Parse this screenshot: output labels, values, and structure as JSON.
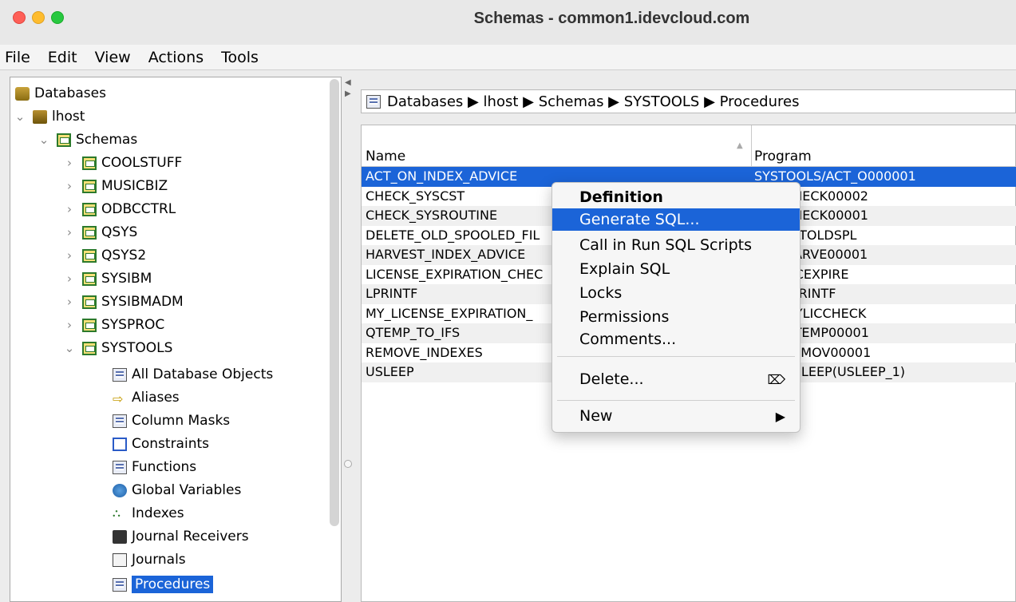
{
  "window": {
    "title": "Schemas - common1.idevcloud.com"
  },
  "menubar": [
    "File",
    "Edit",
    "View",
    "Actions",
    "Tools"
  ],
  "tree": {
    "root": "Databases",
    "host": "lhost",
    "schemas_label": "Schemas",
    "schemas": [
      "COOLSTUFF",
      "MUSICBIZ",
      "ODBCCTRL",
      "QSYS",
      "QSYS2",
      "SYSIBM",
      "SYSIBMADM",
      "SYSPROC",
      "SYSTOOLS"
    ],
    "systools_children": [
      "All Database Objects",
      "Aliases",
      "Column Masks",
      "Constraints",
      "Functions",
      "Global Variables",
      "Indexes",
      "Journal Receivers",
      "Journals",
      "Procedures"
    ],
    "selected": "Procedures"
  },
  "breadcrumb": "Databases ▶ lhost ▶ Schemas ▶ SYSTOOLS ▶ Procedures",
  "table": {
    "columns": [
      "Name",
      "Program"
    ],
    "rows": [
      [
        "ACT_ON_INDEX_ADVICE",
        "SYSTOOLS/ACT_O000001"
      ],
      [
        "CHECK_SYSCST",
        "OLS/CHECK00002"
      ],
      [
        "CHECK_SYSROUTINE",
        "OLS/CHECK00001"
      ],
      [
        "DELETE_OLD_SPOOLED_FIL",
        "OLS/DLTOLDSPL"
      ],
      [
        "HARVEST_INDEX_ADVICE",
        "OLS/HARVE00001"
      ],
      [
        "LICENSE_EXPIRATION_CHEC",
        "OLS/LICEXPIRE"
      ],
      [
        "LPRINTF",
        "OLS/LPRINTF"
      ],
      [
        "MY_LICENSE_EXPIRATION_",
        "OLS/MYLICCHECK"
      ],
      [
        "QTEMP_TO_IFS",
        "OLS/QTEMP00001"
      ],
      [
        "REMOVE_INDEXES",
        "OLS/REMOV00001"
      ],
      [
        "USLEEP",
        "OLS/USLEEP(USLEEP_1)"
      ]
    ]
  },
  "context_menu": {
    "items": [
      "Definition",
      "Generate SQL...",
      "Call in Run SQL Scripts",
      "Explain SQL",
      "Locks",
      "Permissions",
      "Comments...",
      "Delete...",
      "New"
    ],
    "highlighted": "Generate SQL..."
  }
}
